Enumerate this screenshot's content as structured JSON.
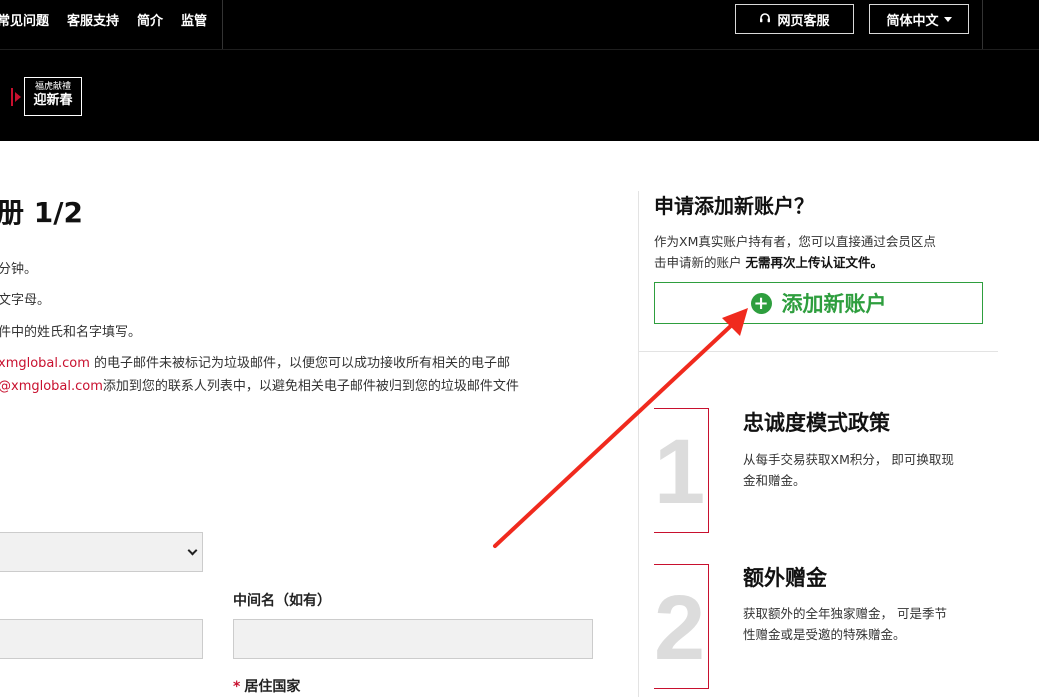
{
  "topnav": {
    "items": [
      "常见问题",
      "客服支持",
      "简介",
      "监管"
    ],
    "service_button": "网页客服",
    "language_button": "简体中文"
  },
  "promo": {
    "line1": "福虎献禮",
    "line2": "迎新春"
  },
  "form": {
    "title": "册 1/2",
    "notes": [
      {
        "text": "分钟。"
      },
      {
        "text": "文字母。"
      },
      {
        "text": "件中的姓氏和名字填写。"
      },
      {
        "red": "xmglobal.com",
        "text": " 的电子邮件未被标记为垃圾邮件，以便您可以成功接收所有相关的电子邮"
      },
      {
        "red": "@xmglobal.com",
        "text": "添加到您的联系人列表中，以避免相关电子邮件被归到您的垃圾邮件文件"
      }
    ],
    "middle_name_label": "中间名（如有）",
    "country_label": "居住国家",
    "required_mark": "*"
  },
  "sidebar": {
    "title": "申请添加新账户？",
    "desc_line1": "作为XM真实账户持有者，您可以直接通过会员区点",
    "desc_line2_plain": "击申请新的账户 ",
    "desc_line2_bold": "无需再次上传认证文件。",
    "add_account_button": "添加新账户",
    "features": [
      {
        "number": "1",
        "title": "忠诚度模式政策",
        "desc_line1": "从每手交易获取XM积分， 即可换取现",
        "desc_line2": "金和赠金。"
      },
      {
        "number": "2",
        "title": "额外赠金",
        "desc_line1": "获取额外的全年独家赠金， 可是季节",
        "desc_line2": "性赠金或是受邀的特殊赠金。"
      }
    ]
  },
  "colors": {
    "accent_green": "#2e9e3e",
    "brand_red": "#c8102e",
    "annotation_arrow": "#f02a1e"
  }
}
